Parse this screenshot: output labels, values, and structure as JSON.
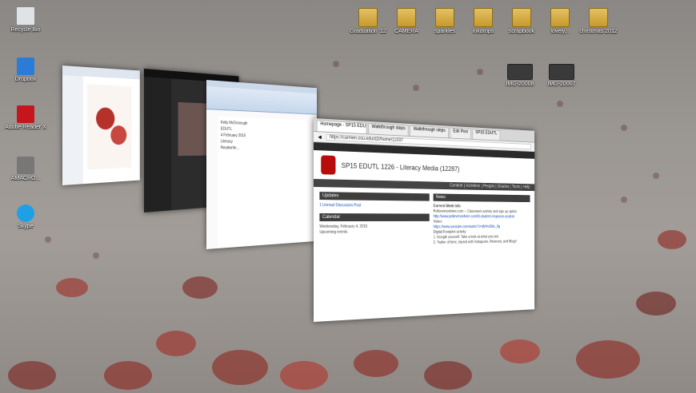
{
  "desktop": {
    "left_icons": [
      {
        "id": "recycle-bin",
        "label": "Recycle Bin",
        "icon": "recycle-bin-icon"
      },
      {
        "id": "dropbox",
        "label": "Dropbox",
        "icon": "dropbox-icon"
      },
      {
        "id": "adobe-reader",
        "label": "Adobe Reader X",
        "icon": "adobe-reader-icon"
      },
      {
        "id": "aw-macro",
        "label": "AMACRO...",
        "icon": "application-icon"
      },
      {
        "id": "skype",
        "label": "Skype",
        "icon": "skype-icon"
      }
    ],
    "top_icons": [
      {
        "id": "graduation",
        "label": "Graduation '12",
        "icon": "folder-icon"
      },
      {
        "id": "camera",
        "label": "CAMERA",
        "icon": "folder-icon"
      },
      {
        "id": "sparkles",
        "label": "sparkles",
        "icon": "folder-icon"
      },
      {
        "id": "inkdrops",
        "label": "inkdrops",
        "icon": "folder-icon"
      },
      {
        "id": "scrapbook",
        "label": "scrapbook",
        "icon": "folder-icon"
      },
      {
        "id": "lovely",
        "label": "lovely...",
        "icon": "folder-icon"
      },
      {
        "id": "christmas",
        "label": "christmas 2012",
        "icon": "folder-icon"
      }
    ],
    "right_icons": [
      {
        "id": "img1",
        "label": "IMG-20008",
        "icon": "image-icon"
      },
      {
        "id": "img2",
        "label": "IMG-20007",
        "icon": "image-icon"
      }
    ]
  },
  "browser": {
    "tabs": [
      {
        "label": "Homepage - SP15 EDUTL",
        "active": true
      },
      {
        "label": "Walkthrough steps",
        "active": false
      },
      {
        "label": "Walkthrough steps",
        "active": false
      },
      {
        "label": "Edit Post",
        "active": false
      },
      {
        "label": "SP15 EDUTL",
        "active": false
      }
    ],
    "url": "https://carmen.osu.edu/d2l/home/11037",
    "course_title": "SP15 EDUTL 1226 - Literacy Media (12287)",
    "nav": "Content | Activities | People | Grades | Tools | Help",
    "updates_header": "Updates",
    "updates_item": "1 Unread Discussion Post",
    "calendar_header": "Calendar",
    "calendar_date": "Wednesday, February 4, 2015",
    "upcoming": "Upcoming events",
    "news_header": "News",
    "news_title": "Current Week Info",
    "news_line1": "Pollseverywhere.com -- Classroom activity and sign up option",
    "news_link": "http://www.polleverywhere.com/i3-student-response-system",
    "video_label": "Video:",
    "video_link": "https://www.youtube.com/watch?v=jNHvSlNc_lfg",
    "footprint": "Digital Footprint activity",
    "google": "1. Google yourself. Take a look at what you see.",
    "twitter": "2. Twitter of time, repeat with Instagram, Pinterest, and Blogs!"
  },
  "word": {
    "lines": [
      "Kelly McDonough",
      "EDUTL",
      "4 February 2015",
      "Literacy",
      "Readwrite..."
    ]
  },
  "colors": {
    "osu_red": "#b80b0b",
    "dark": "#1d1d1d"
  }
}
